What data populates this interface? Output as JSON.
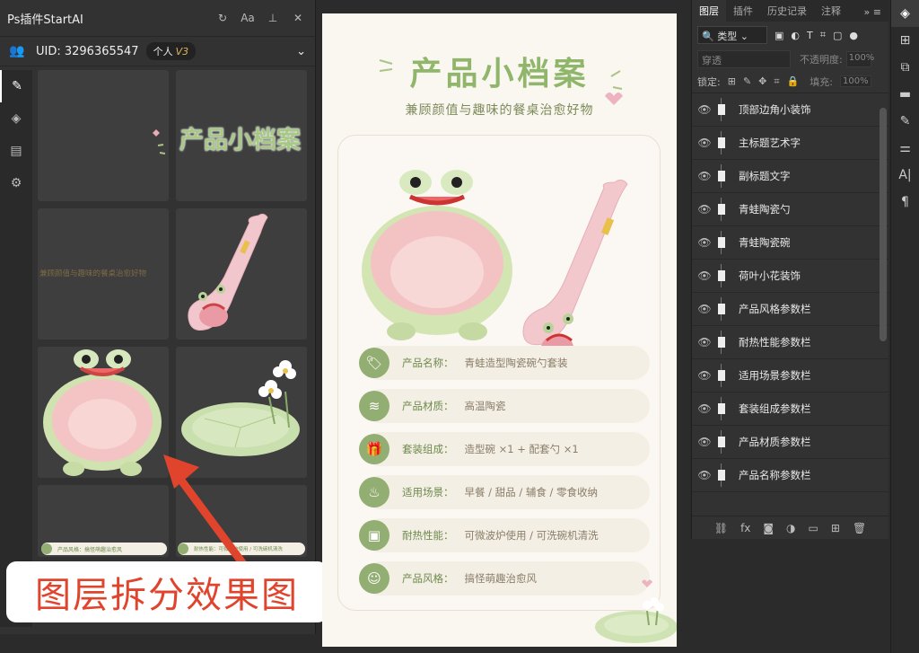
{
  "plugin": {
    "title": "Ps插件StartAI",
    "toolbar": [
      "↻",
      "Aa",
      "⊥",
      "✕"
    ],
    "uid_label": "UID: 3296365547",
    "plan_label": "个人",
    "plan_level": "V3",
    "sidebar_icons": [
      "pen-icon",
      "layers-icon",
      "clipboard-icon",
      "gear-icon"
    ],
    "thumb_title": "产品小档案",
    "thumb_subtitle": "兼顾颜值与趣味的餐桌治愈好物",
    "thumb_row1": "产品风格：搞怪萌趣治愈风",
    "thumb_row2": "耐热性能：可微波炉使用 / 可洗碗机清洗"
  },
  "overlay_label": "图层拆分效果图",
  "poster": {
    "title": "产品小档案",
    "subtitle": "兼顾颜值与趣味的餐桌治愈好物",
    "rows": [
      {
        "icon": "🏷",
        "key": "产品名称：",
        "value": "青蛙造型陶瓷碗勺套装"
      },
      {
        "icon": "≋",
        "key": "产品材质：",
        "value": "高温陶瓷"
      },
      {
        "icon": "🎁",
        "key": "套装组成：",
        "value": "造型碗 ×1 + 配套勺 ×1"
      },
      {
        "icon": "♨",
        "key": "适用场景：",
        "value": "早餐 / 甜品 / 辅食 / 零食收纳"
      },
      {
        "icon": "▣",
        "key": "耐热性能：",
        "value": "可微波炉使用 / 可洗碗机清洗"
      },
      {
        "icon": "☺",
        "key": "产品风格：",
        "value": "搞怪萌趣治愈风"
      }
    ]
  },
  "layers": {
    "tabs": [
      "图层",
      "插件",
      "历史记录",
      "注释"
    ],
    "kind_filter": "类型",
    "blend_mode": "穿透",
    "opacity_label": "不透明度:",
    "opacity_value": "100%",
    "lock_label": "锁定:",
    "fill_label": "填充:",
    "fill_value": "100%",
    "items": [
      "顶部边角小装饰",
      "主标题艺术字",
      "副标题文字",
      "青蛙陶瓷勺",
      "青蛙陶瓷碗",
      "荷叶小花装饰",
      "产品风格参数栏",
      "耐热性能参数栏",
      "适用场景参数栏",
      "套装组成参数栏",
      "产品材质参数栏",
      "产品名称参数栏"
    ]
  },
  "colors": {
    "accent_green": "#93ae72",
    "title_green": "#8fb66a",
    "overlay_red": "#e0442c",
    "ps_dark": "#323232"
  }
}
